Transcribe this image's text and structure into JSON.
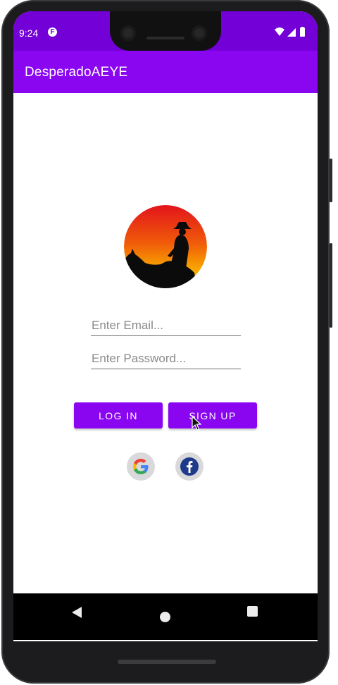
{
  "status_bar": {
    "time": "9:24",
    "app_icon": "F",
    "icons": [
      "wifi-icon",
      "signal-icon",
      "battery-icon"
    ]
  },
  "app_bar": {
    "title": "DesperadoAEYE"
  },
  "login_form": {
    "email_placeholder": "Enter Email...",
    "password_placeholder": "Enter Password...",
    "login_label": "LOG IN",
    "signup_label": "SIGN UP"
  },
  "social": {
    "google_icon": "google-icon",
    "facebook_icon": "facebook-icon"
  },
  "navigation": {
    "buttons": [
      "back-icon",
      "home-icon",
      "recents-icon"
    ]
  },
  "colors": {
    "status_bar": "#7300d6",
    "app_bar": "#8a05f0",
    "button": "#8a05f0",
    "screen_bg": "#ffffff"
  }
}
